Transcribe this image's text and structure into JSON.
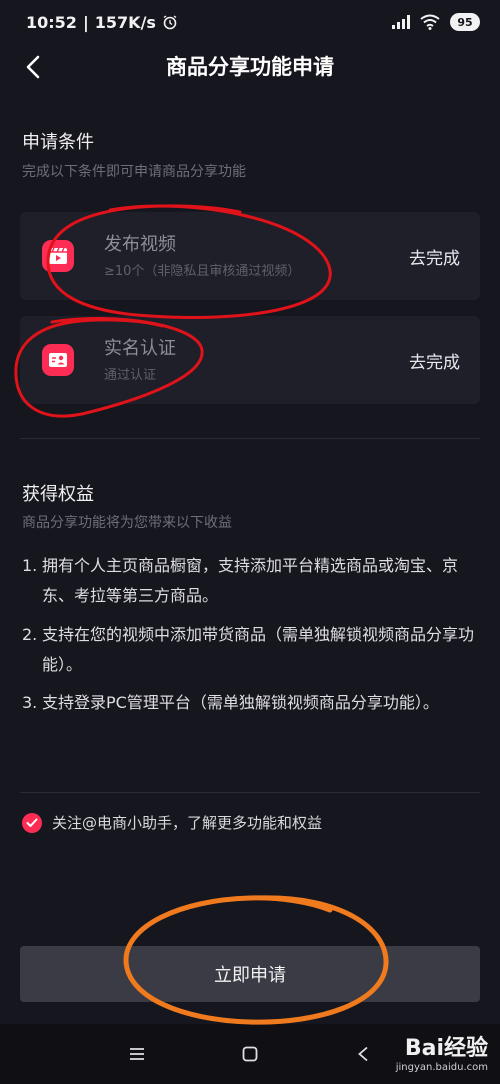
{
  "status_bar": {
    "time": "10:52",
    "speed": "157K/s",
    "battery": "95"
  },
  "nav": {
    "title": "商品分享功能申请"
  },
  "conditions": {
    "title": "申请条件",
    "subtitle": "完成以下条件即可申请商品分享功能",
    "items": [
      {
        "title": "发布视频",
        "desc": "≥10个（非隐私且审核通过视频）",
        "action": "去完成",
        "icon": "video-icon"
      },
      {
        "title": "实名认证",
        "desc": "通过认证",
        "action": "去完成",
        "icon": "id-card-icon"
      }
    ]
  },
  "benefits": {
    "title": "获得权益",
    "subtitle": "商品分享功能将为您带来以下收益",
    "items": [
      {
        "num": "1.",
        "text": "拥有个人主页商品橱窗，支持添加平台精选商品或淘宝、京东、考拉等第三方商品。"
      },
      {
        "num": "2.",
        "text": "支持在您的视频中添加带货商品（需单独解锁视频商品分享功能）。"
      },
      {
        "num": "3.",
        "text": "支持登录PC管理平台（需单独解锁视频商品分享功能）。"
      }
    ]
  },
  "follow": {
    "label": "关注@电商小助手，了解更多功能和权益",
    "checked": true
  },
  "apply_button": "立即申请",
  "colors": {
    "background": "#16161e",
    "card": "#1e1f28",
    "accent": "#fc2c55",
    "annotation_red": "#e0121a",
    "annotation_orange": "#f07a1e"
  },
  "watermark": {
    "brand": "Bai经验",
    "url": "jingyan.baidu.com"
  }
}
